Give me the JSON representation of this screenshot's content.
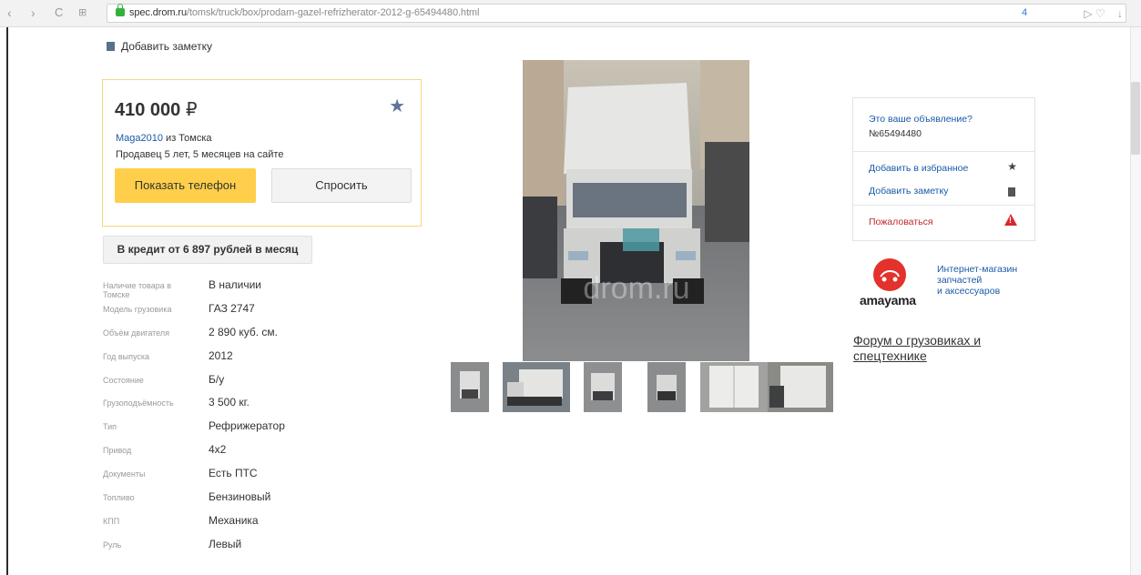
{
  "browser": {
    "url_domain": "spec.drom.ru",
    "url_path": "/tomsk/truck/box/prodam-gazel-refrizherator-2012-g-65494480.html",
    "badge_count": "4"
  },
  "note_top": {
    "label": "Добавить заметку"
  },
  "listing": {
    "price": "410 000",
    "currency": "₽",
    "seller_name": "Maga2010",
    "seller_city": " из Томска",
    "seller_age": "Продавец 5 лет, 5 месяцев на сайте",
    "phone_button": "Показать телефон",
    "ask_button": "Спросить",
    "credit_button": "В кредит от 6 897 рублей в месяц"
  },
  "specs": [
    {
      "label": "Наличие товара в Томске",
      "value": "В наличии"
    },
    {
      "label": "Модель грузовика",
      "value": "ГАЗ 2747"
    },
    {
      "label": "Объём двигателя",
      "value": "2 890 куб. см."
    },
    {
      "label": "Год выпуска",
      "value": "2012"
    },
    {
      "label": "Состояние",
      "value": "Б/у"
    },
    {
      "label": "Грузоподъёмность",
      "value": "3 500 кг."
    },
    {
      "label": "Тип",
      "value": "Рефрижератор"
    },
    {
      "label": "Привод",
      "value": "4х2"
    },
    {
      "label": "Документы",
      "value": "Есть ПТС"
    },
    {
      "label": "Топливо",
      "value": "Бензиновый"
    },
    {
      "label": "КПП",
      "value": "Механика"
    },
    {
      "label": "Руль",
      "value": "Левый"
    }
  ],
  "photo": {
    "watermark": "drom.ru"
  },
  "owner_panel": {
    "question": "Это ваше объявление?",
    "number": "№65494480",
    "add_favorite": "Добавить в избранное",
    "add_note": "Добавить заметку",
    "complain": "Пожаловаться"
  },
  "ad": {
    "brand": "amayama",
    "desc_line1": "Интернет-магазин",
    "desc_line2": "запчастей",
    "desc_line3": "и аксессуаров"
  },
  "forum_link": "Форум о грузовиках и спецтехнике",
  "colors": {
    "accent_yellow": "#ffce4a",
    "link_blue": "#1a5aa8",
    "alert_red": "#d7292d"
  }
}
